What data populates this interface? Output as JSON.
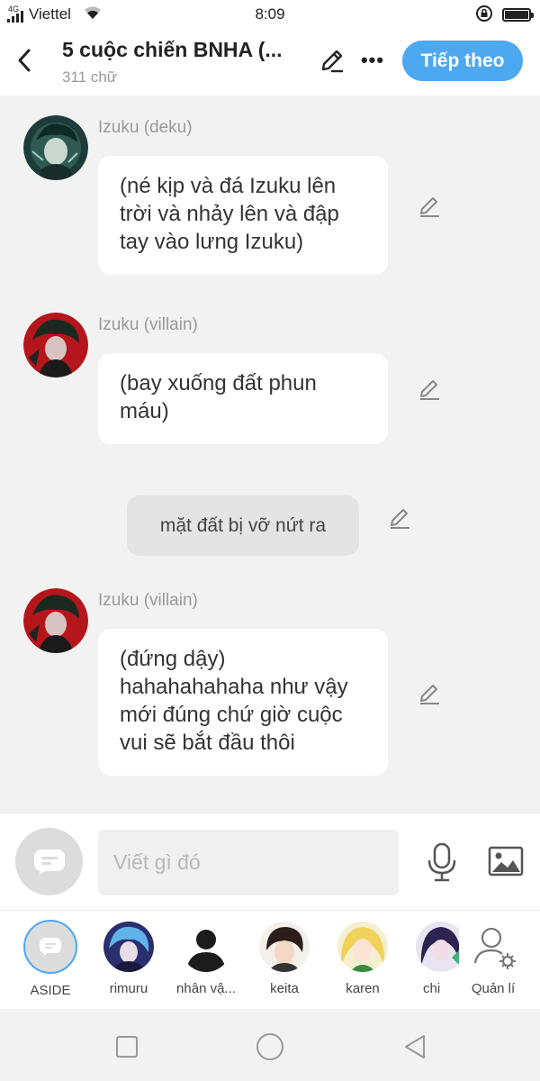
{
  "status_bar": {
    "network": "4G",
    "carrier": "Viettel",
    "time": "8:09"
  },
  "header": {
    "title": "5 cuộc chiến BNHA (...",
    "subtitle": "311 chữ",
    "next_button": "Tiếp theo"
  },
  "messages": [
    {
      "sender": "Izuku (deku)",
      "text": "(né kịp và đá Izuku lên trời và nhảy lên và đập tay vào lưng Izuku)"
    },
    {
      "sender": "Izuku (villain)",
      "text": "(bay xuống đất phun máu)"
    },
    {
      "narration": "mặt đất bị vỡ nứt ra"
    },
    {
      "sender": "Izuku (villain)",
      "text": "(đứng dậy) hahahahahaha như vậy mới đúng chứ giờ cuộc vui sẽ bắt đầu thôi"
    }
  ],
  "composer": {
    "placeholder": "Viết gì đó"
  },
  "characters": [
    {
      "label": "ASIDE"
    },
    {
      "label": "rimuru"
    },
    {
      "label": "nhân vậ..."
    },
    {
      "label": "keita"
    },
    {
      "label": "karen"
    },
    {
      "label": "chi"
    },
    {
      "label": "Quản lí"
    }
  ],
  "colors": {
    "accent": "#4da8f0",
    "background": "#f2f2f2",
    "bubble": "#ffffff",
    "narration_bubble": "#e4e4e4"
  }
}
